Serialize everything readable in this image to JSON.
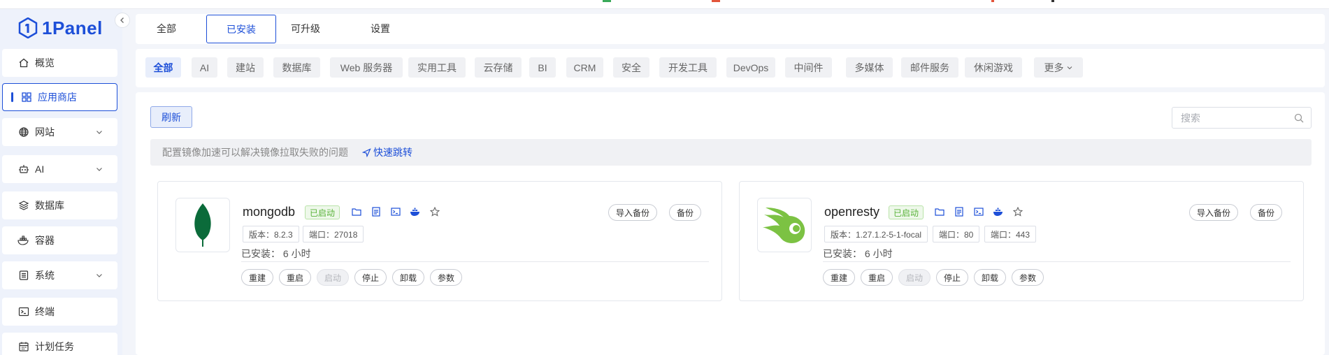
{
  "brand": {
    "name": "1Panel",
    "accent": "#1d4fd8"
  },
  "sidebar": {
    "items": [
      {
        "label": "概览",
        "icon": "home-icon"
      },
      {
        "label": "应用商店",
        "icon": "grid-icon",
        "active": true
      },
      {
        "label": "网站",
        "icon": "globe-icon",
        "expandable": true
      },
      {
        "label": "AI",
        "icon": "robot-icon",
        "expandable": true
      },
      {
        "label": "数据库",
        "icon": "layers-icon"
      },
      {
        "label": "容器",
        "icon": "docker-icon"
      },
      {
        "label": "系统",
        "icon": "server-icon",
        "expandable": true
      },
      {
        "label": "终端",
        "icon": "terminal-icon"
      },
      {
        "label": "计划任务",
        "icon": "calendar-icon"
      }
    ]
  },
  "tabs": [
    {
      "label": "全部"
    },
    {
      "label": "已安装",
      "active": true
    },
    {
      "label": "可升级"
    },
    {
      "label": "设置"
    }
  ],
  "categories": [
    {
      "label": "全部",
      "active": true
    },
    {
      "label": "AI"
    },
    {
      "label": "建站"
    },
    {
      "label": "数据库"
    },
    {
      "label": "Web 服务器"
    },
    {
      "label": "实用工具"
    },
    {
      "label": "云存储"
    },
    {
      "label": "BI"
    },
    {
      "label": "CRM"
    },
    {
      "label": "安全"
    },
    {
      "label": "开发工具"
    },
    {
      "label": "DevOps"
    },
    {
      "label": "中间件"
    },
    {
      "label": "多媒体"
    },
    {
      "label": "邮件服务"
    },
    {
      "label": "休闲游戏"
    },
    {
      "label": "更多"
    }
  ],
  "toolbar": {
    "refresh_label": "刷新",
    "search_placeholder": "搜索"
  },
  "notice": {
    "text": "配置镜像加速可以解决镜像拉取失败的问题",
    "link_label": "快速跳转"
  },
  "apps": [
    {
      "name": "mongodb",
      "status": "已启动",
      "tags": [
        "版本：8.2.3",
        "端口：27018"
      ],
      "installed": "已安装：  6 小时",
      "import_backup_label": "导入备份",
      "backup_label": "备份",
      "actions": [
        "重建",
        "重启",
        "启动",
        "停止",
        "卸载",
        "参数"
      ]
    },
    {
      "name": "openresty",
      "status": "已启动",
      "tags": [
        "版本：1.27.1.2-5-1-focal",
        "端口：80",
        "端口：443"
      ],
      "installed": "已安装：  6 小时",
      "import_backup_label": "导入备份",
      "backup_label": "备份",
      "actions": [
        "重建",
        "重启",
        "启动",
        "停止",
        "卸载",
        "参数"
      ]
    }
  ]
}
